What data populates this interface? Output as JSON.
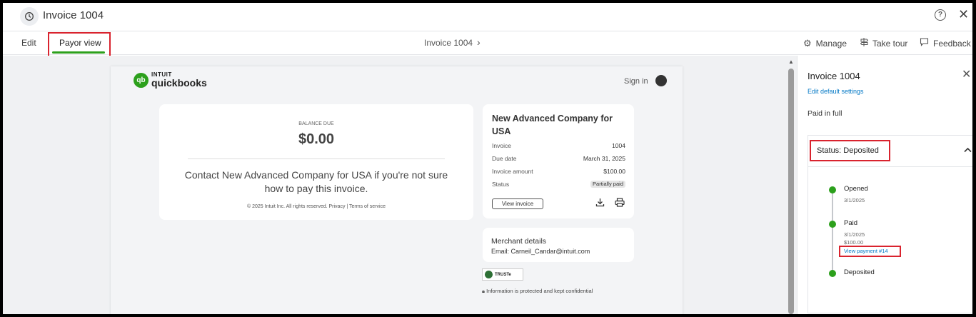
{
  "window": {
    "title": "Invoice 1004",
    "help_icon": "question-circle",
    "close_glyph": "✕"
  },
  "tabs": [
    {
      "label": "Edit"
    },
    {
      "label": "Payor view",
      "active": true
    }
  ],
  "breadcrumb": {
    "label": "Invoice 1004",
    "chevron": "›"
  },
  "toolbar": {
    "manage": "Manage",
    "take_tour": "Take tour",
    "feedback": "Feedback"
  },
  "document": {
    "brand_small": "INTUIT",
    "brand_big": "quickbooks",
    "sign_in": "Sign in",
    "balance": {
      "label": "BALANCE DUE",
      "amount": "$0.00",
      "contact": "Contact New Advanced Company for USA if you're not sure how to pay this invoice.",
      "copyright": "© 2025 Intuit Inc. All rights reserved. Privacy | Terms of service"
    },
    "invoice_card": {
      "company": "New Advanced Company for USA",
      "rows": [
        {
          "label": "Invoice",
          "value": "1004"
        },
        {
          "label": "Due date",
          "value": "March 31, 2025"
        },
        {
          "label": "Invoice amount",
          "value": "$100.00"
        },
        {
          "label": "Status",
          "value": "Partially paid"
        }
      ],
      "view_invoice": "View invoice"
    },
    "merchant": {
      "title": "Merchant details",
      "email": "Email: Carneil_Candar@intuit.com"
    },
    "truste": "TRUSTe",
    "protected": "Information is protected and kept confidential"
  },
  "panel": {
    "title": "Invoice 1004",
    "edit_link": "Edit default settings",
    "paid_text": "Paid in full",
    "status_label": "Status: Deposited",
    "timeline": [
      {
        "title": "Opened",
        "date": "3/1/2025"
      },
      {
        "title": "Paid",
        "date": "3/1/2025",
        "amount": "$100.00",
        "link": "View payment #14"
      },
      {
        "title": "Deposited"
      }
    ]
  },
  "colors": {
    "accent_green": "#2ca01c",
    "highlight_red": "#d9232e",
    "link_blue": "#0077c5"
  }
}
